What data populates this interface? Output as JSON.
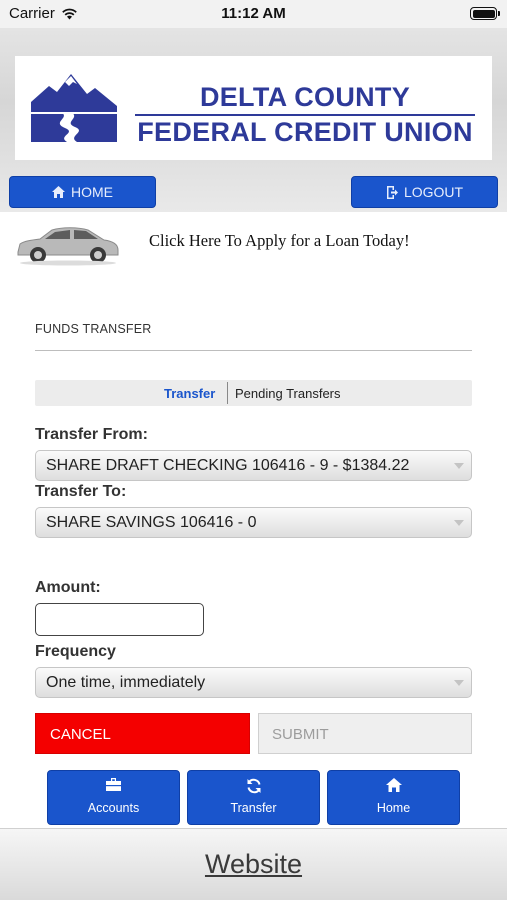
{
  "status_bar": {
    "carrier": "Carrier",
    "time": "11:12 AM"
  },
  "logo": {
    "line1": "DELTA COUNTY",
    "line2": "FEDERAL CREDIT UNION",
    "brand_color": "#2e3a99"
  },
  "nav": {
    "home_label": "HOME",
    "logout_label": "LOGOUT",
    "home_icon": "home-icon",
    "logout_icon": "logout-icon"
  },
  "promo": {
    "text": "Click Here To Apply for a Loan Today!",
    "icon": "car-icon"
  },
  "section": {
    "title": "FUNDS TRANSFER"
  },
  "tabs": [
    {
      "label": "Transfer",
      "active": true
    },
    {
      "label": "Pending Transfers",
      "active": false
    }
  ],
  "form": {
    "from_label": "Transfer From:",
    "from_value": "SHARE DRAFT CHECKING 106416 - 9 - $1384.22",
    "to_label": "Transfer To:",
    "to_value": "SHARE SAVINGS 106416 - 0",
    "amount_label": "Amount:",
    "amount_value": "",
    "frequency_label": "Frequency",
    "frequency_value": "One time, immediately"
  },
  "actions": {
    "cancel_label": "CANCEL",
    "submit_label": "SUBMIT",
    "cancel_color": "#f40000"
  },
  "dock": [
    {
      "label": "Accounts",
      "icon": "briefcase-icon"
    },
    {
      "label": "Transfer",
      "icon": "refresh-icon"
    },
    {
      "label": "Home",
      "icon": "home-icon"
    }
  ],
  "footer": {
    "link_label": "Website"
  },
  "colors": {
    "accent": "#1a55cc"
  }
}
